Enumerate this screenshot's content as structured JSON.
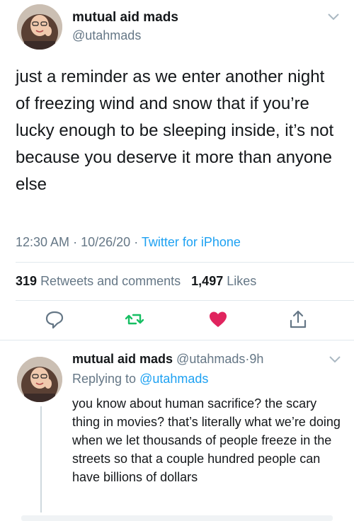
{
  "tweet": {
    "author_name": "mutual aid mads",
    "author_handle": "@utahmads",
    "text": "just a reminder as we enter another night of freezing wind and snow that if you’re lucky enough to be sleeping inside, it’s not because you deserve it more than anyone else",
    "time": "12:30 AM",
    "date": "10/26/20",
    "separator": "·",
    "source": "Twitter for iPhone",
    "retweets_count": "319",
    "retweets_label": "Retweets and comments",
    "likes_count": "1,497",
    "likes_label": "Likes",
    "icons": [
      "reply-icon",
      "retweet-icon",
      "like-icon-filled",
      "share-icon",
      "chevron-down-icon"
    ],
    "colors": {
      "like": "#e0245e",
      "retweet": "#17bf63",
      "link": "#1da1f2",
      "muted": "#657786"
    }
  },
  "reply": {
    "author_name": "mutual aid mads",
    "author_handle": "@utahmads",
    "separator": "·",
    "age": "9h",
    "replying_prefix": "Replying to",
    "replying_to": "@utahmads",
    "text": "you know about human sacrifice? the scary thing in movies? that’s literally what we’re doing when we let thousands of people freeze in the streets so that a couple hundred people can have billions of dollars"
  }
}
